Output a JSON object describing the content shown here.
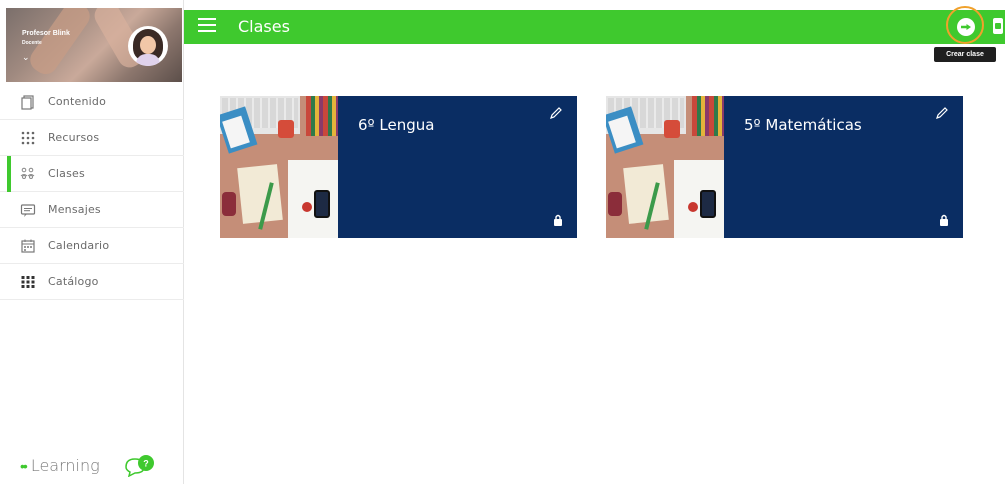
{
  "colors": {
    "accent": "#3fc92e",
    "card_bg": "#0a2d63",
    "highlight": "#f0a12b",
    "tooltip_bg": "#1f1f1f"
  },
  "profile": {
    "name": "Profesor Blink",
    "role": "Docente",
    "chevron": "⌄"
  },
  "sidebar": {
    "items": [
      {
        "label": "Contenido",
        "icon": "document-icon",
        "active": false
      },
      {
        "label": "Recursos",
        "icon": "grid-dots-icon",
        "active": false
      },
      {
        "label": "Clases",
        "icon": "people-icon",
        "active": true
      },
      {
        "label": "Mensajes",
        "icon": "message-icon",
        "active": false
      },
      {
        "label": "Calendario",
        "icon": "calendar-icon",
        "active": false
      },
      {
        "label": "Catálogo",
        "icon": "grid-squares-icon",
        "active": false
      }
    ],
    "brand": {
      "dots": "••",
      "text": "Learning"
    }
  },
  "header": {
    "title": "Clases",
    "tooltip": "Crear clase"
  },
  "classes": [
    {
      "name": "6º Lengua"
    },
    {
      "name": "5º Matemáticas"
    }
  ]
}
